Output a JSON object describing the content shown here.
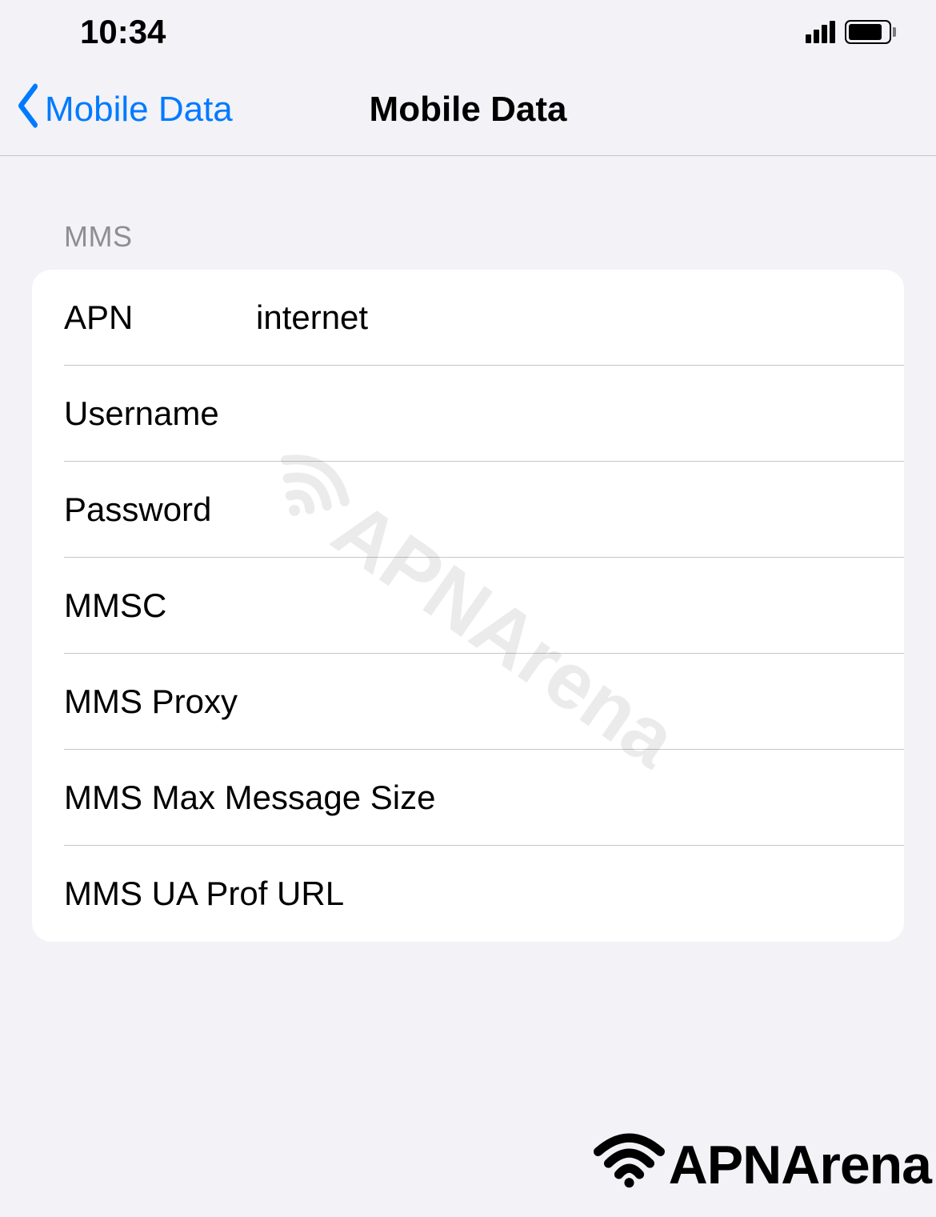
{
  "statusBar": {
    "time": "10:34"
  },
  "nav": {
    "back": "Mobile Data",
    "title": "Mobile Data"
  },
  "section": {
    "header": "MMS",
    "rows": [
      {
        "label": "APN",
        "value": "internet"
      },
      {
        "label": "Username",
        "value": ""
      },
      {
        "label": "Password",
        "value": ""
      },
      {
        "label": "MMSC",
        "value": ""
      },
      {
        "label": "MMS Proxy",
        "value": ""
      },
      {
        "label": "MMS Max Message Size",
        "value": ""
      },
      {
        "label": "MMS UA Prof URL",
        "value": ""
      }
    ]
  },
  "watermark": "APNArena",
  "footer": "APNArena"
}
